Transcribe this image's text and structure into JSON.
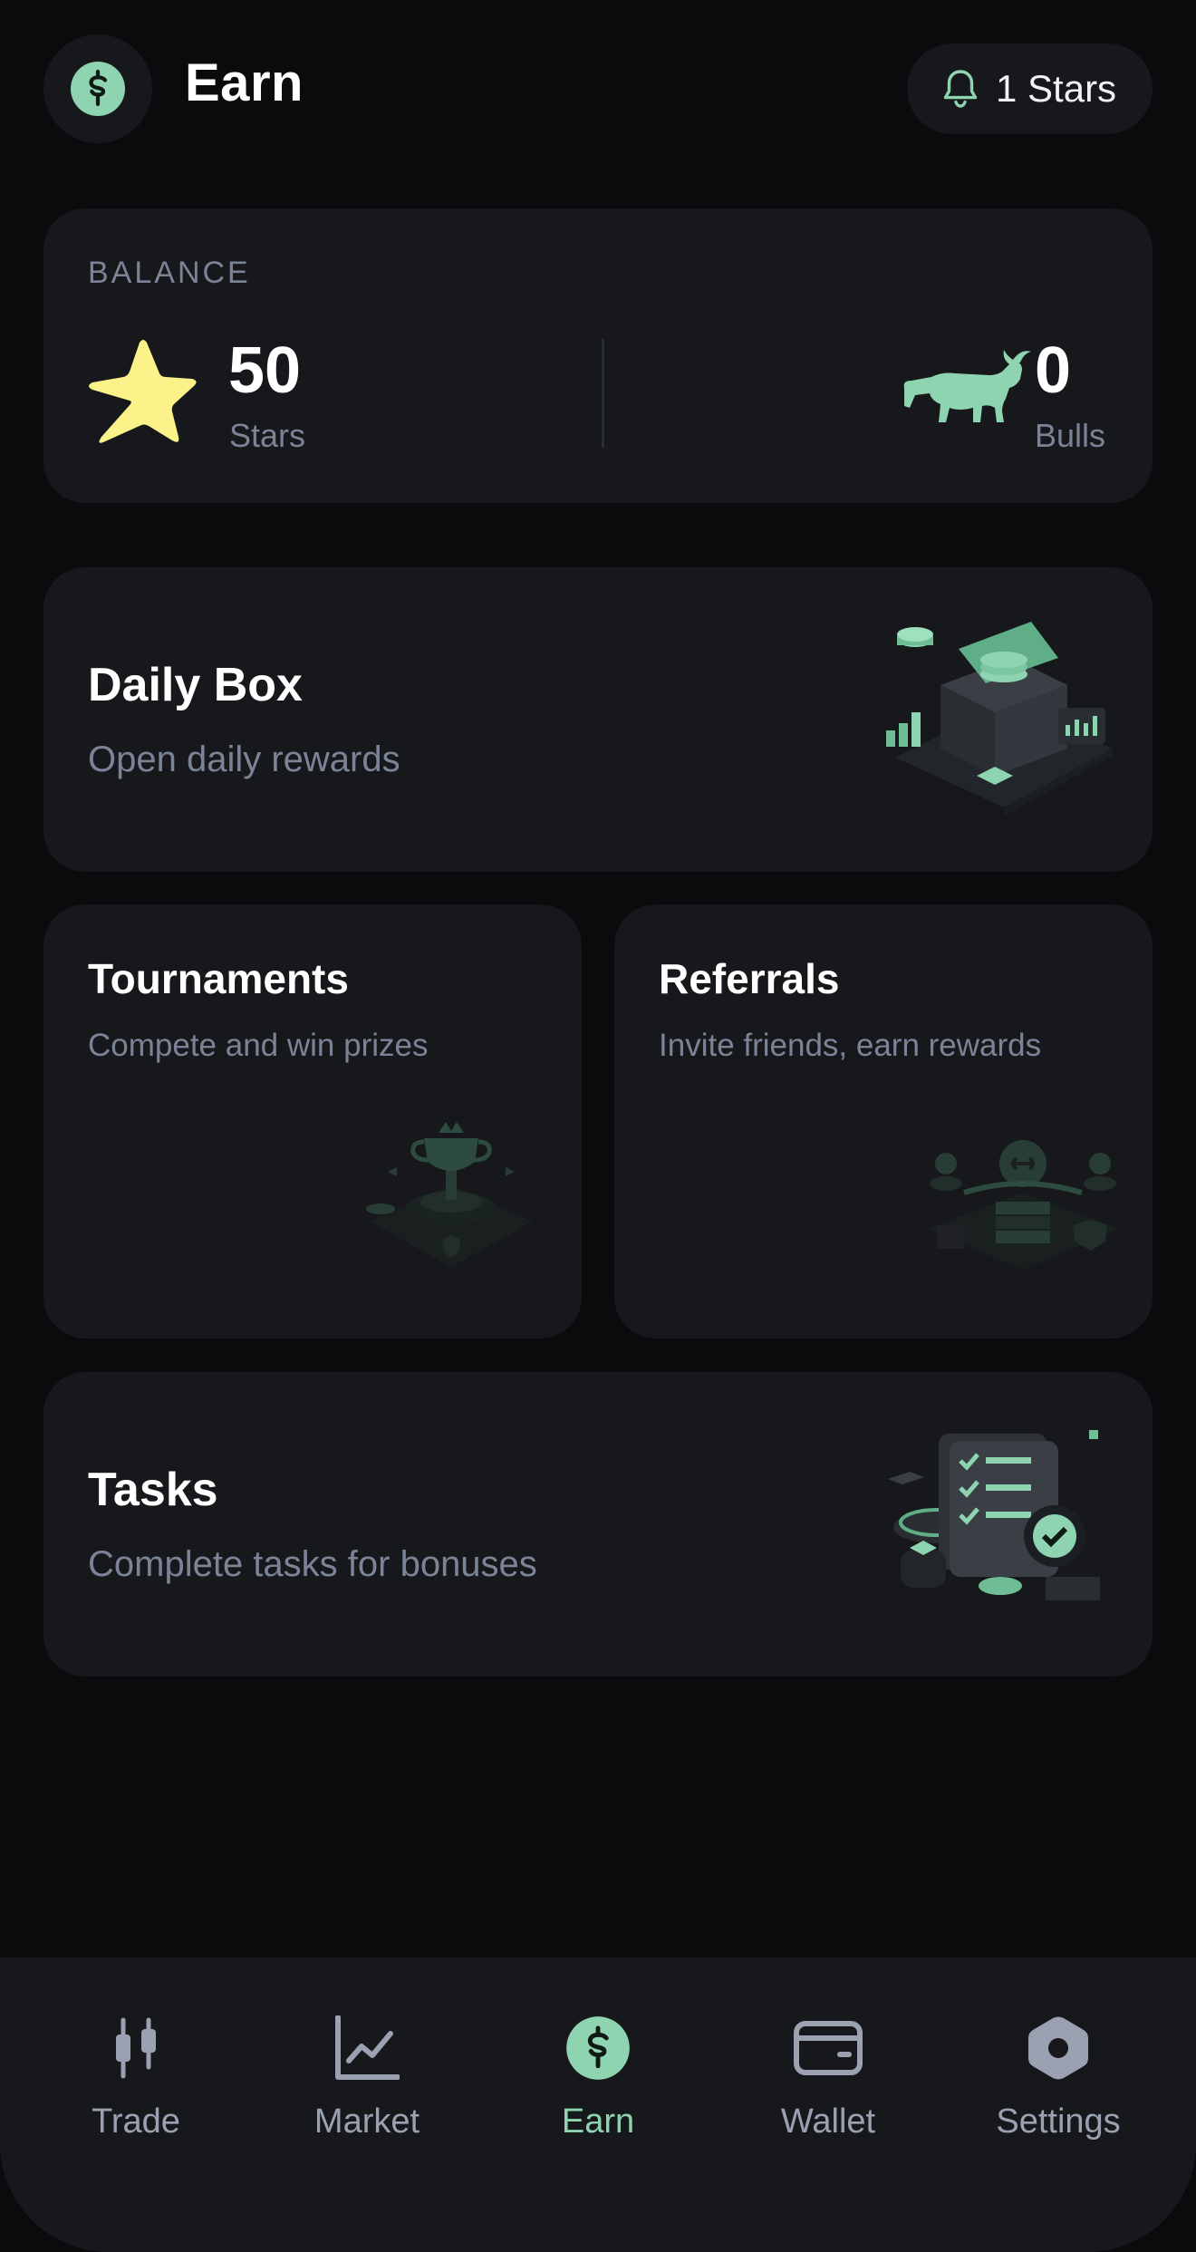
{
  "header": {
    "title": "Earn",
    "stars_pill_label": "1 Stars"
  },
  "balance": {
    "label": "BALANCE",
    "stars_value": "50",
    "stars_unit": "Stars",
    "bulls_value": "0",
    "bulls_unit": "Bulls"
  },
  "features": {
    "daily_box": {
      "title": "Daily Box",
      "subtitle": "Open daily rewards"
    },
    "tournaments": {
      "title": "Tournaments",
      "subtitle": "Compete and win prizes"
    },
    "referrals": {
      "title": "Referrals",
      "subtitle": "Invite friends, earn rewards"
    },
    "tasks": {
      "title": "Tasks",
      "subtitle": "Complete tasks for bonuses"
    }
  },
  "nav": {
    "items": [
      {
        "label": "Trade",
        "icon": "candlestick-icon",
        "active": false
      },
      {
        "label": "Market",
        "icon": "line-chart-icon",
        "active": false
      },
      {
        "label": "Earn",
        "icon": "dollar-coin-icon",
        "active": true
      },
      {
        "label": "Wallet",
        "icon": "wallet-icon",
        "active": false
      },
      {
        "label": "Settings",
        "icon": "hexagon-settings-icon",
        "active": false
      }
    ]
  },
  "colors": {
    "background": "#0a0b0d",
    "card": "#16181c",
    "accent_green": "#8fd4b0",
    "star_yellow": "#fcf28a",
    "muted_text": "#7b8496"
  }
}
